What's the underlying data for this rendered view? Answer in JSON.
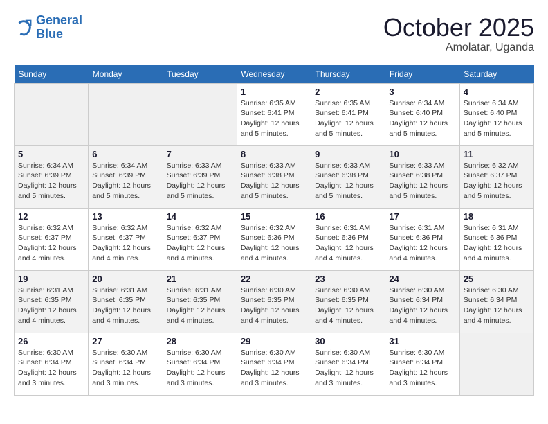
{
  "logo": {
    "line1": "General",
    "line2": "Blue"
  },
  "title": "October 2025",
  "location": "Amolatar, Uganda",
  "days_of_week": [
    "Sunday",
    "Monday",
    "Tuesday",
    "Wednesday",
    "Thursday",
    "Friday",
    "Saturday"
  ],
  "weeks": [
    [
      {
        "day": "",
        "info": ""
      },
      {
        "day": "",
        "info": ""
      },
      {
        "day": "",
        "info": ""
      },
      {
        "day": "1",
        "sunrise": "Sunrise: 6:35 AM",
        "sunset": "Sunset: 6:41 PM",
        "daylight": "Daylight: 12 hours and 5 minutes."
      },
      {
        "day": "2",
        "sunrise": "Sunrise: 6:35 AM",
        "sunset": "Sunset: 6:41 PM",
        "daylight": "Daylight: 12 hours and 5 minutes."
      },
      {
        "day": "3",
        "sunrise": "Sunrise: 6:34 AM",
        "sunset": "Sunset: 6:40 PM",
        "daylight": "Daylight: 12 hours and 5 minutes."
      },
      {
        "day": "4",
        "sunrise": "Sunrise: 6:34 AM",
        "sunset": "Sunset: 6:40 PM",
        "daylight": "Daylight: 12 hours and 5 minutes."
      }
    ],
    [
      {
        "day": "5",
        "sunrise": "Sunrise: 6:34 AM",
        "sunset": "Sunset: 6:39 PM",
        "daylight": "Daylight: 12 hours and 5 minutes."
      },
      {
        "day": "6",
        "sunrise": "Sunrise: 6:34 AM",
        "sunset": "Sunset: 6:39 PM",
        "daylight": "Daylight: 12 hours and 5 minutes."
      },
      {
        "day": "7",
        "sunrise": "Sunrise: 6:33 AM",
        "sunset": "Sunset: 6:39 PM",
        "daylight": "Daylight: 12 hours and 5 minutes."
      },
      {
        "day": "8",
        "sunrise": "Sunrise: 6:33 AM",
        "sunset": "Sunset: 6:38 PM",
        "daylight": "Daylight: 12 hours and 5 minutes."
      },
      {
        "day": "9",
        "sunrise": "Sunrise: 6:33 AM",
        "sunset": "Sunset: 6:38 PM",
        "daylight": "Daylight: 12 hours and 5 minutes."
      },
      {
        "day": "10",
        "sunrise": "Sunrise: 6:33 AM",
        "sunset": "Sunset: 6:38 PM",
        "daylight": "Daylight: 12 hours and 5 minutes."
      },
      {
        "day": "11",
        "sunrise": "Sunrise: 6:32 AM",
        "sunset": "Sunset: 6:37 PM",
        "daylight": "Daylight: 12 hours and 5 minutes."
      }
    ],
    [
      {
        "day": "12",
        "sunrise": "Sunrise: 6:32 AM",
        "sunset": "Sunset: 6:37 PM",
        "daylight": "Daylight: 12 hours and 4 minutes."
      },
      {
        "day": "13",
        "sunrise": "Sunrise: 6:32 AM",
        "sunset": "Sunset: 6:37 PM",
        "daylight": "Daylight: 12 hours and 4 minutes."
      },
      {
        "day": "14",
        "sunrise": "Sunrise: 6:32 AM",
        "sunset": "Sunset: 6:37 PM",
        "daylight": "Daylight: 12 hours and 4 minutes."
      },
      {
        "day": "15",
        "sunrise": "Sunrise: 6:32 AM",
        "sunset": "Sunset: 6:36 PM",
        "daylight": "Daylight: 12 hours and 4 minutes."
      },
      {
        "day": "16",
        "sunrise": "Sunrise: 6:31 AM",
        "sunset": "Sunset: 6:36 PM",
        "daylight": "Daylight: 12 hours and 4 minutes."
      },
      {
        "day": "17",
        "sunrise": "Sunrise: 6:31 AM",
        "sunset": "Sunset: 6:36 PM",
        "daylight": "Daylight: 12 hours and 4 minutes."
      },
      {
        "day": "18",
        "sunrise": "Sunrise: 6:31 AM",
        "sunset": "Sunset: 6:36 PM",
        "daylight": "Daylight: 12 hours and 4 minutes."
      }
    ],
    [
      {
        "day": "19",
        "sunrise": "Sunrise: 6:31 AM",
        "sunset": "Sunset: 6:35 PM",
        "daylight": "Daylight: 12 hours and 4 minutes."
      },
      {
        "day": "20",
        "sunrise": "Sunrise: 6:31 AM",
        "sunset": "Sunset: 6:35 PM",
        "daylight": "Daylight: 12 hours and 4 minutes."
      },
      {
        "day": "21",
        "sunrise": "Sunrise: 6:31 AM",
        "sunset": "Sunset: 6:35 PM",
        "daylight": "Daylight: 12 hours and 4 minutes."
      },
      {
        "day": "22",
        "sunrise": "Sunrise: 6:30 AM",
        "sunset": "Sunset: 6:35 PM",
        "daylight": "Daylight: 12 hours and 4 minutes."
      },
      {
        "day": "23",
        "sunrise": "Sunrise: 6:30 AM",
        "sunset": "Sunset: 6:35 PM",
        "daylight": "Daylight: 12 hours and 4 minutes."
      },
      {
        "day": "24",
        "sunrise": "Sunrise: 6:30 AM",
        "sunset": "Sunset: 6:34 PM",
        "daylight": "Daylight: 12 hours and 4 minutes."
      },
      {
        "day": "25",
        "sunrise": "Sunrise: 6:30 AM",
        "sunset": "Sunset: 6:34 PM",
        "daylight": "Daylight: 12 hours and 4 minutes."
      }
    ],
    [
      {
        "day": "26",
        "sunrise": "Sunrise: 6:30 AM",
        "sunset": "Sunset: 6:34 PM",
        "daylight": "Daylight: 12 hours and 3 minutes."
      },
      {
        "day": "27",
        "sunrise": "Sunrise: 6:30 AM",
        "sunset": "Sunset: 6:34 PM",
        "daylight": "Daylight: 12 hours and 3 minutes."
      },
      {
        "day": "28",
        "sunrise": "Sunrise: 6:30 AM",
        "sunset": "Sunset: 6:34 PM",
        "daylight": "Daylight: 12 hours and 3 minutes."
      },
      {
        "day": "29",
        "sunrise": "Sunrise: 6:30 AM",
        "sunset": "Sunset: 6:34 PM",
        "daylight": "Daylight: 12 hours and 3 minutes."
      },
      {
        "day": "30",
        "sunrise": "Sunrise: 6:30 AM",
        "sunset": "Sunset: 6:34 PM",
        "daylight": "Daylight: 12 hours and 3 minutes."
      },
      {
        "day": "31",
        "sunrise": "Sunrise: 6:30 AM",
        "sunset": "Sunset: 6:34 PM",
        "daylight": "Daylight: 12 hours and 3 minutes."
      },
      {
        "day": "",
        "info": ""
      }
    ]
  ]
}
